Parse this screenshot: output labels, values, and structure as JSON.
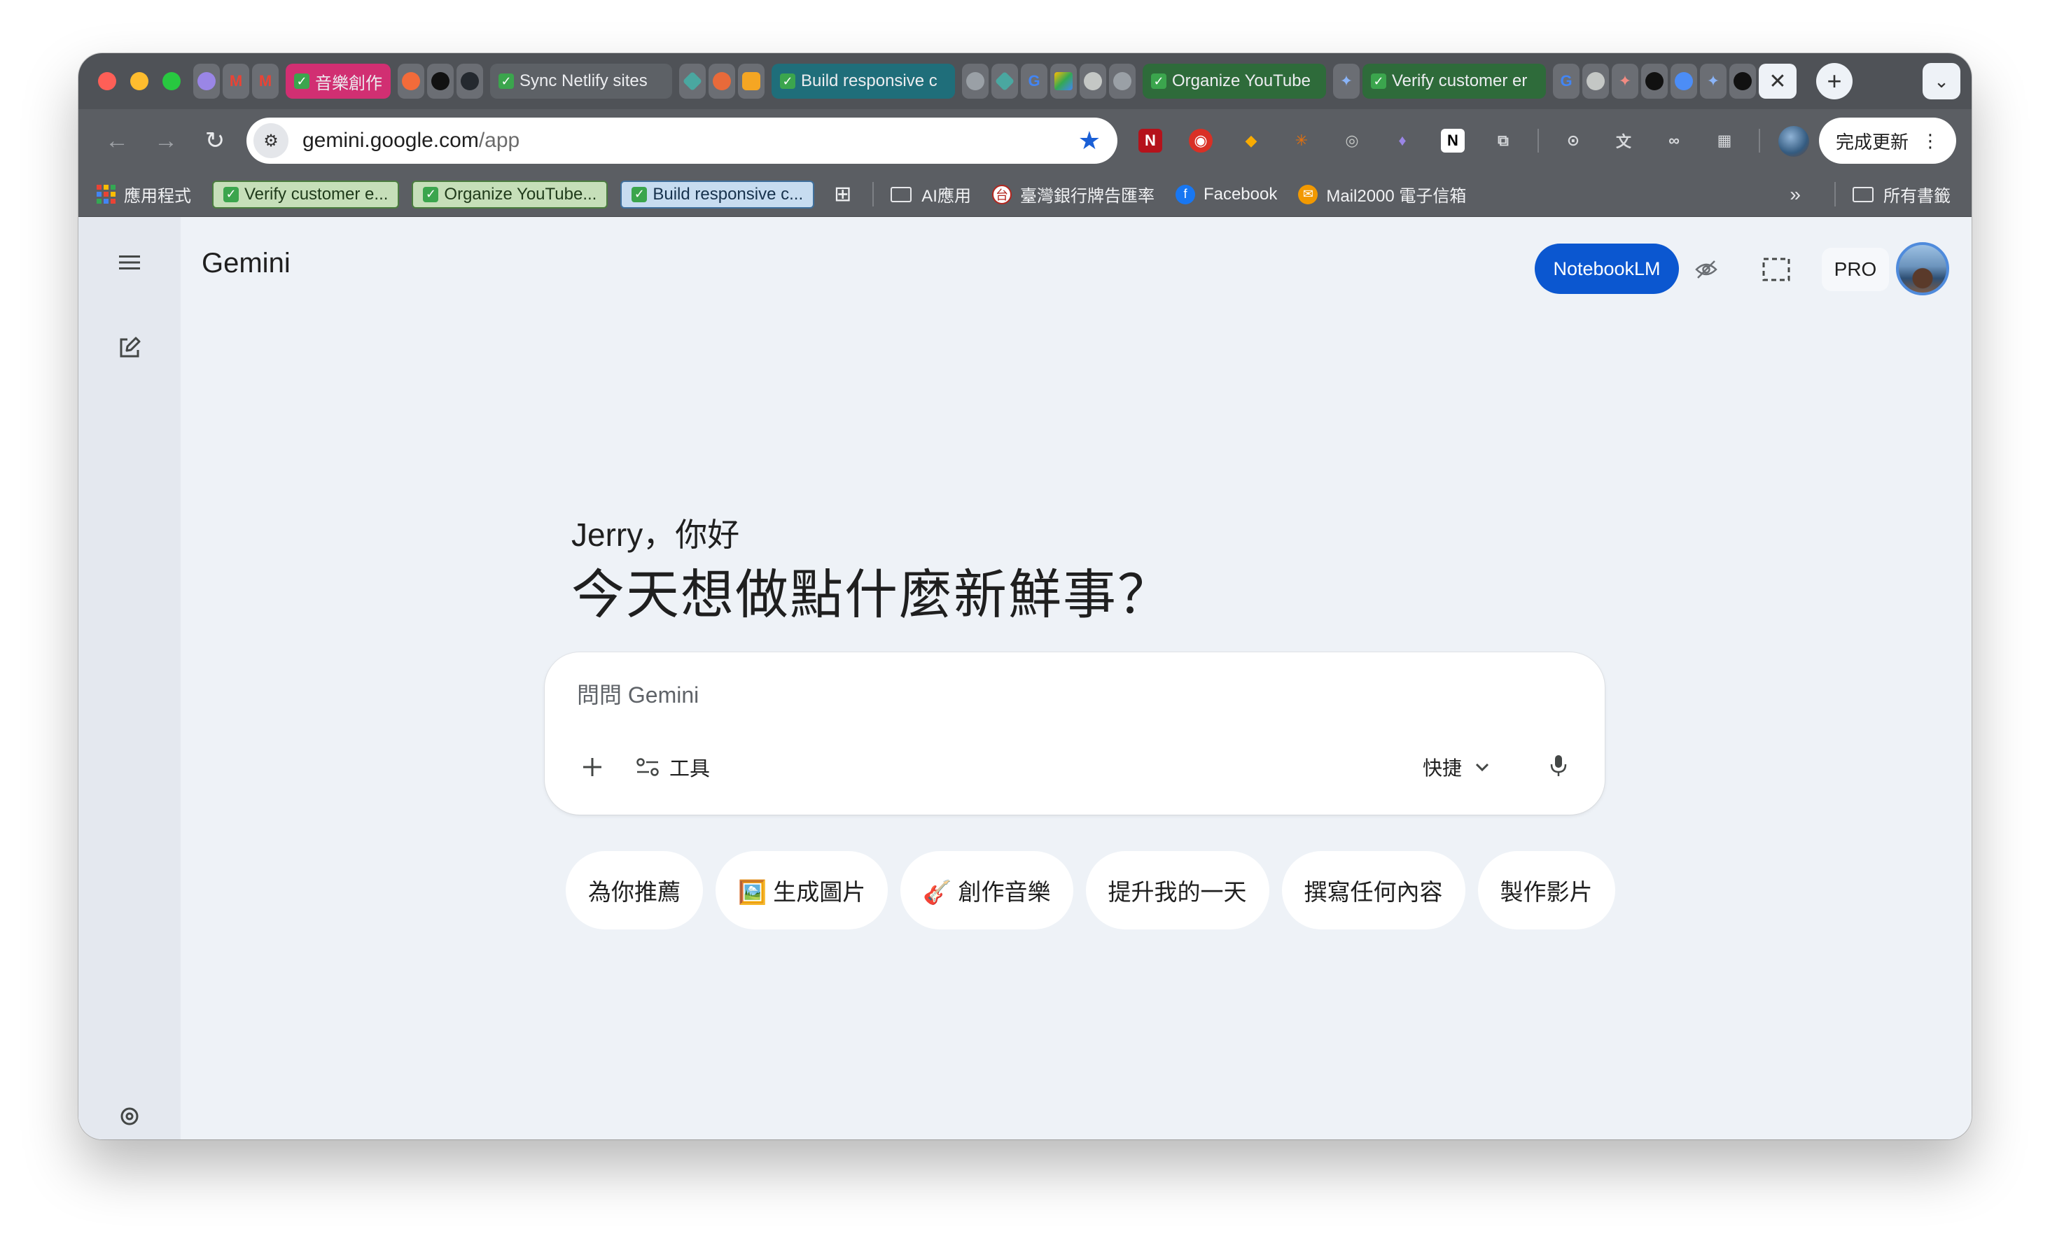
{
  "tabs": {
    "items": [
      {
        "label": "音樂創作",
        "style": "pink"
      },
      {
        "label": "Sync Netlify sites"
      },
      {
        "label": "Build responsive c"
      },
      {
        "label": "Organize YouTube"
      },
      {
        "label": "Verify customer er"
      }
    ],
    "active_close": "✕",
    "new_tab": "+"
  },
  "toolbar": {
    "url_host": "gemini.google.com",
    "url_path": "/app",
    "update_label": "完成更新"
  },
  "bookmarks": {
    "apps_label": "應用程式",
    "boxed": [
      "Verify customer e...",
      "Organize YouTube...",
      "Build responsive c..."
    ],
    "ai_folder": "AI應用",
    "bank": "臺灣銀行牌告匯率",
    "facebook": "Facebook",
    "mail": "Mail2000 電子信箱",
    "all_bookmarks": "所有書籤"
  },
  "page": {
    "brand": "Gemini",
    "notebook_label": "NotebookLM",
    "pro_label": "PRO",
    "greeting": "Jerry，你好",
    "headline": "今天想做點什麼新鮮事？",
    "prompt_placeholder": "問問 Gemini",
    "tools_label": "工具",
    "mode_label": "快捷",
    "chips": [
      "為你推薦",
      "🖼️ 生成圖片",
      "🎸 創作音樂",
      "提升我的一天",
      "撰寫任何內容",
      "製作影片"
    ]
  },
  "colors": {
    "accent_blue": "#0b57d0",
    "page_bg": "#eef2f7",
    "chrome_dark": "#5b5e63"
  }
}
